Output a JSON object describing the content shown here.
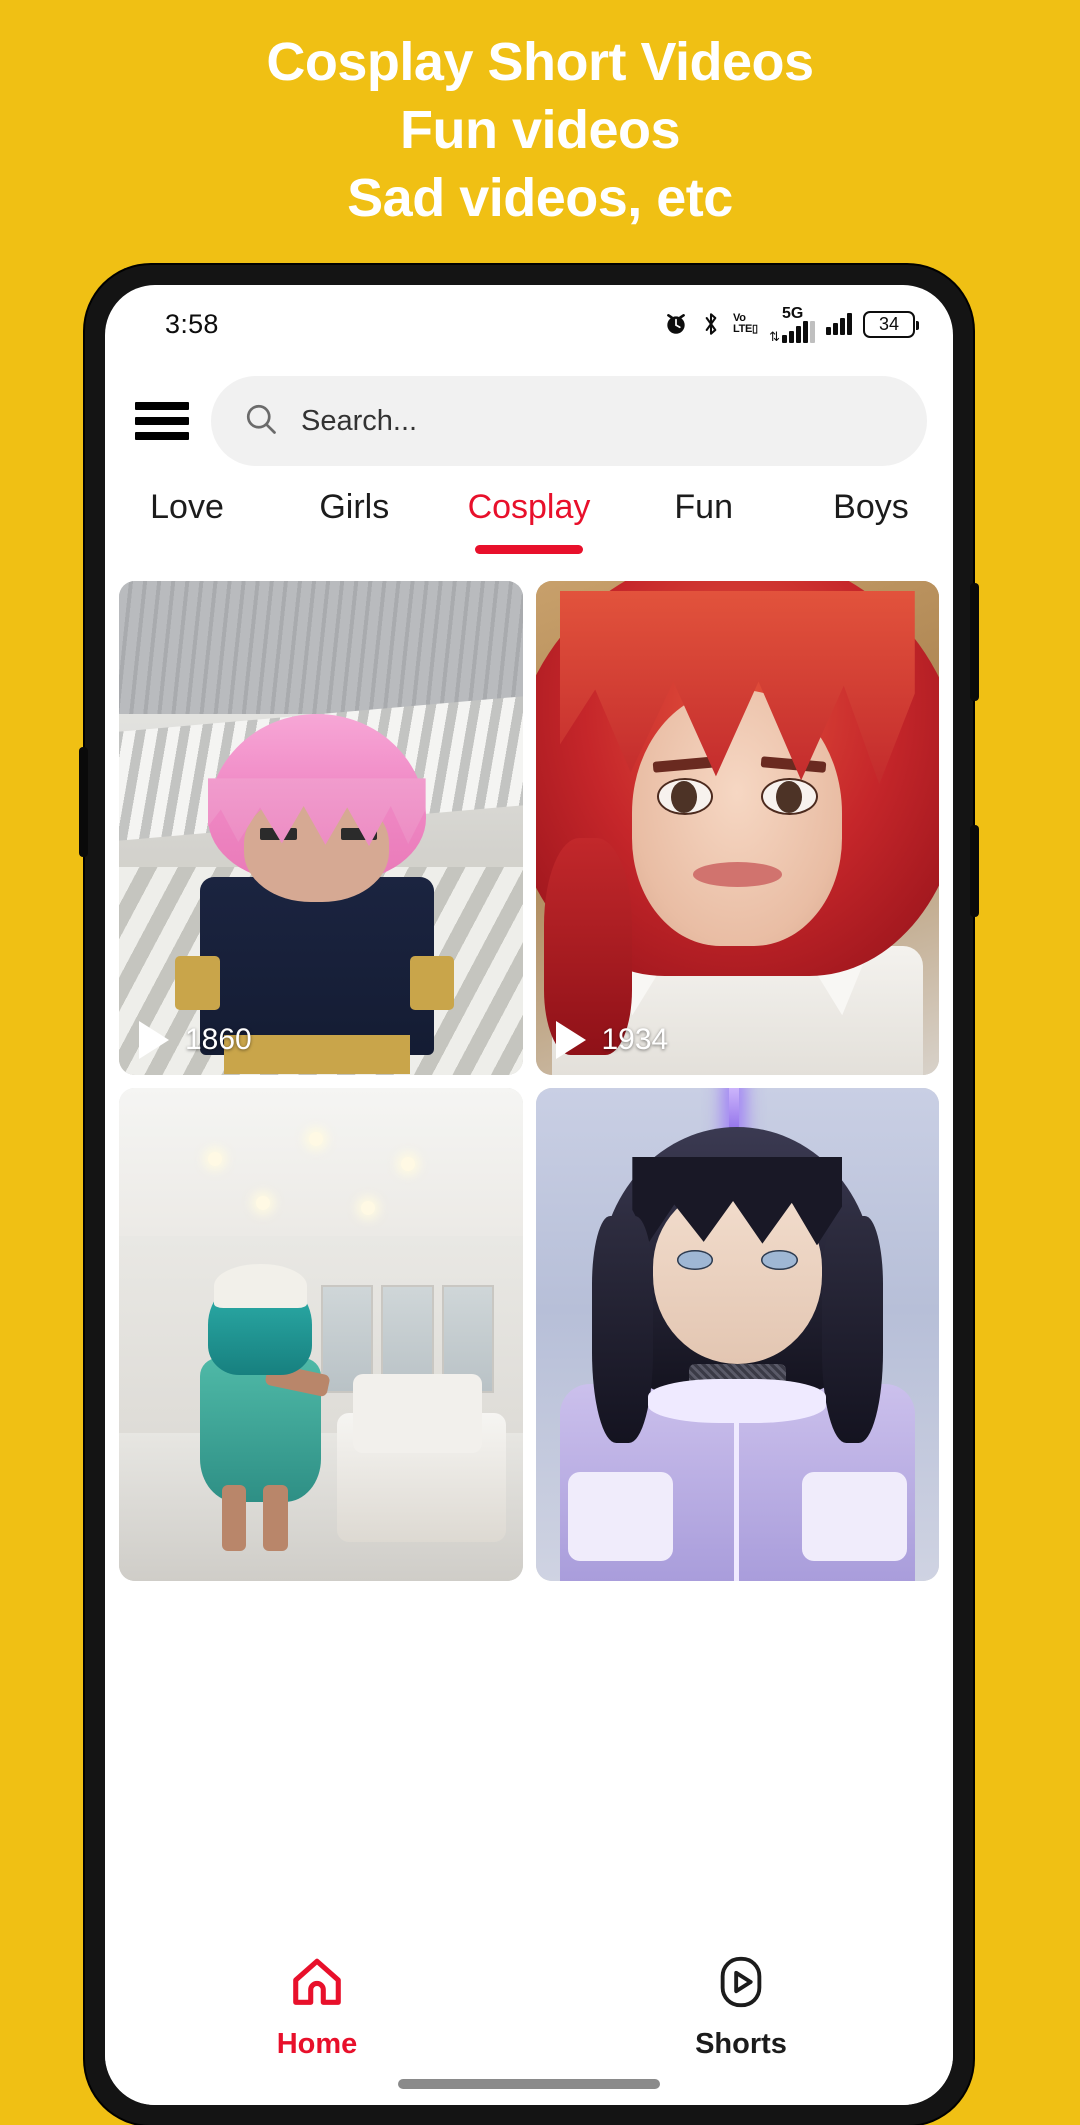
{
  "promo": {
    "lines": [
      "Cosplay Short Videos",
      "Fun videos",
      "Sad videos, etc"
    ],
    "background_color": "#F0C014",
    "text_color": "#FFFFFF"
  },
  "statusbar": {
    "time": "3:58",
    "volte_top": "Vo",
    "volte_bottom": "LTE",
    "network": "5G",
    "battery_level": "34",
    "icons": [
      "alarm-icon",
      "bluetooth-icon",
      "volte-icon",
      "signal-5g-icon",
      "signal-bars-icon",
      "battery-icon"
    ]
  },
  "topbar": {
    "menu_icon": "hamburger-menu-icon",
    "search": {
      "icon": "search-icon",
      "placeholder": "Search..."
    }
  },
  "tabs": {
    "items": [
      {
        "label": "Love",
        "active": false
      },
      {
        "label": "Girls",
        "active": false
      },
      {
        "label": "Cosplay",
        "active": true
      },
      {
        "label": "Fun",
        "active": false
      },
      {
        "label": "Boys",
        "active": false
      }
    ],
    "active_color": "#E8102B",
    "inactive_color": "#1C1C1C"
  },
  "grid": {
    "cards": [
      {
        "name": "video-card-anya-cosplay",
        "views": "1860",
        "play_icon": "play-icon",
        "show_meta": true
      },
      {
        "name": "video-card-red-hair-cosplay",
        "views": "1934",
        "play_icon": "play-icon",
        "show_meta": true
      },
      {
        "name": "video-card-teal-hair-cosplay",
        "views": "",
        "play_icon": "play-icon",
        "show_meta": false
      },
      {
        "name": "video-card-dark-hair-cosplay",
        "views": "",
        "play_icon": "play-icon",
        "show_meta": false
      }
    ]
  },
  "bottomnav": {
    "items": [
      {
        "label": "Home",
        "icon": "home-icon",
        "active": true
      },
      {
        "label": "Shorts",
        "icon": "shorts-play-icon",
        "active": false
      }
    ],
    "active_color": "#E8102B"
  }
}
